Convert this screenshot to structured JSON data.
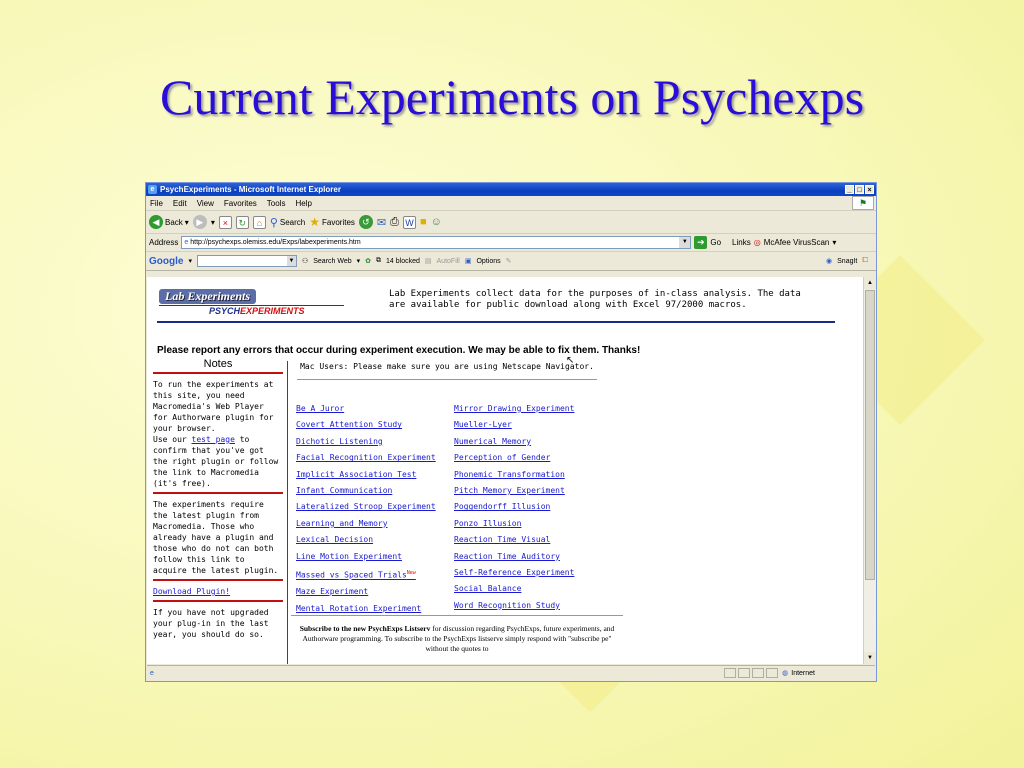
{
  "slide": {
    "title": "Current Experiments on Psychexps"
  },
  "browser": {
    "window_title": "PsychExperiments - Microsoft Internet Explorer",
    "menu": [
      "File",
      "Edit",
      "View",
      "Favorites",
      "Tools",
      "Help"
    ],
    "toolbar": {
      "back": "Back",
      "search": "Search",
      "favorites": "Favorites"
    },
    "address_label": "Address",
    "address_url": "http://psychexps.olemiss.edu/Exps/labexperiments.htm",
    "go_label": "Go",
    "links_label": "Links",
    "mcafee_label": "McAfee VirusScan",
    "google_bar": {
      "logo": "Google",
      "search_web": "Search Web",
      "blocked": "14 blocked",
      "autofill": "AutoFill",
      "options": "Options",
      "snagit": "SnagIt"
    },
    "status_zone": "Internet"
  },
  "page": {
    "logo_top": "Lab Experiments",
    "logo_bottom_a": "PSYCH",
    "logo_bottom_b": "EXPERIMENTS",
    "description": "Lab Experiments collect data for the purposes of in-class analysis. The data are available for public download along with Excel 97/2000 macros.",
    "report": "Please report any errors that occur during experiment execution. We may be able to fix them. Thanks!",
    "notes": {
      "title": "Notes",
      "block1_a": "To run the experiments at this site, you need Macromedia's Web Player for Authorware plugin for your browser.",
      "block1_b": "Use our ",
      "block1_link": "test page",
      "block1_c": " to confirm that you've got the right plugin or follow the link to Macromedia (it's free).",
      "block2": "The experiments require the latest plugin from Macromedia. Those who already have a plugin and those who do not can both follow this link to acquire the latest plugin.",
      "download": "Download Plugin!",
      "block3": "If you have not upgraded your plug-in in the last year, you should do so."
    },
    "mac_note": "Mac Users: Please make sure you are using Netscape Navigator.",
    "experiments_left": [
      "Be A Juror",
      "Covert Attention Study",
      "Dichotic Listening",
      "Facial Recognition Experiment",
      "Implicit Association Test",
      "Infant Communication",
      "Lateralized Stroop Experiment",
      "Learning and Memory",
      "Lexical Decision",
      "Line Motion Experiment",
      "Massed vs Spaced Trials",
      "Maze Experiment",
      "Mental Rotation Experiment"
    ],
    "new_badge": "New",
    "experiments_right": [
      "Mirror Drawing Experiment",
      "Mueller-Lyer",
      "Numerical Memory",
      "Perception of Gender",
      "Phonemic Transformation",
      "Pitch Memory Experiment",
      "Poggendorff Illusion",
      "Ponzo Illusion",
      "Reaction Time Visual",
      "Reaction Time Auditory",
      "Self-Reference Experiment",
      "Social Balance",
      "Word Recognition Study"
    ],
    "subscribe_bold": "Subscribe to the new PsychExps Listserv",
    "subscribe_rest": " for discussion regarding PsychExps, future experiments, and Authorware programming. To subscribe to the PsychExps listserve simply respond with \"subscribe pe\" without the quotes to"
  }
}
